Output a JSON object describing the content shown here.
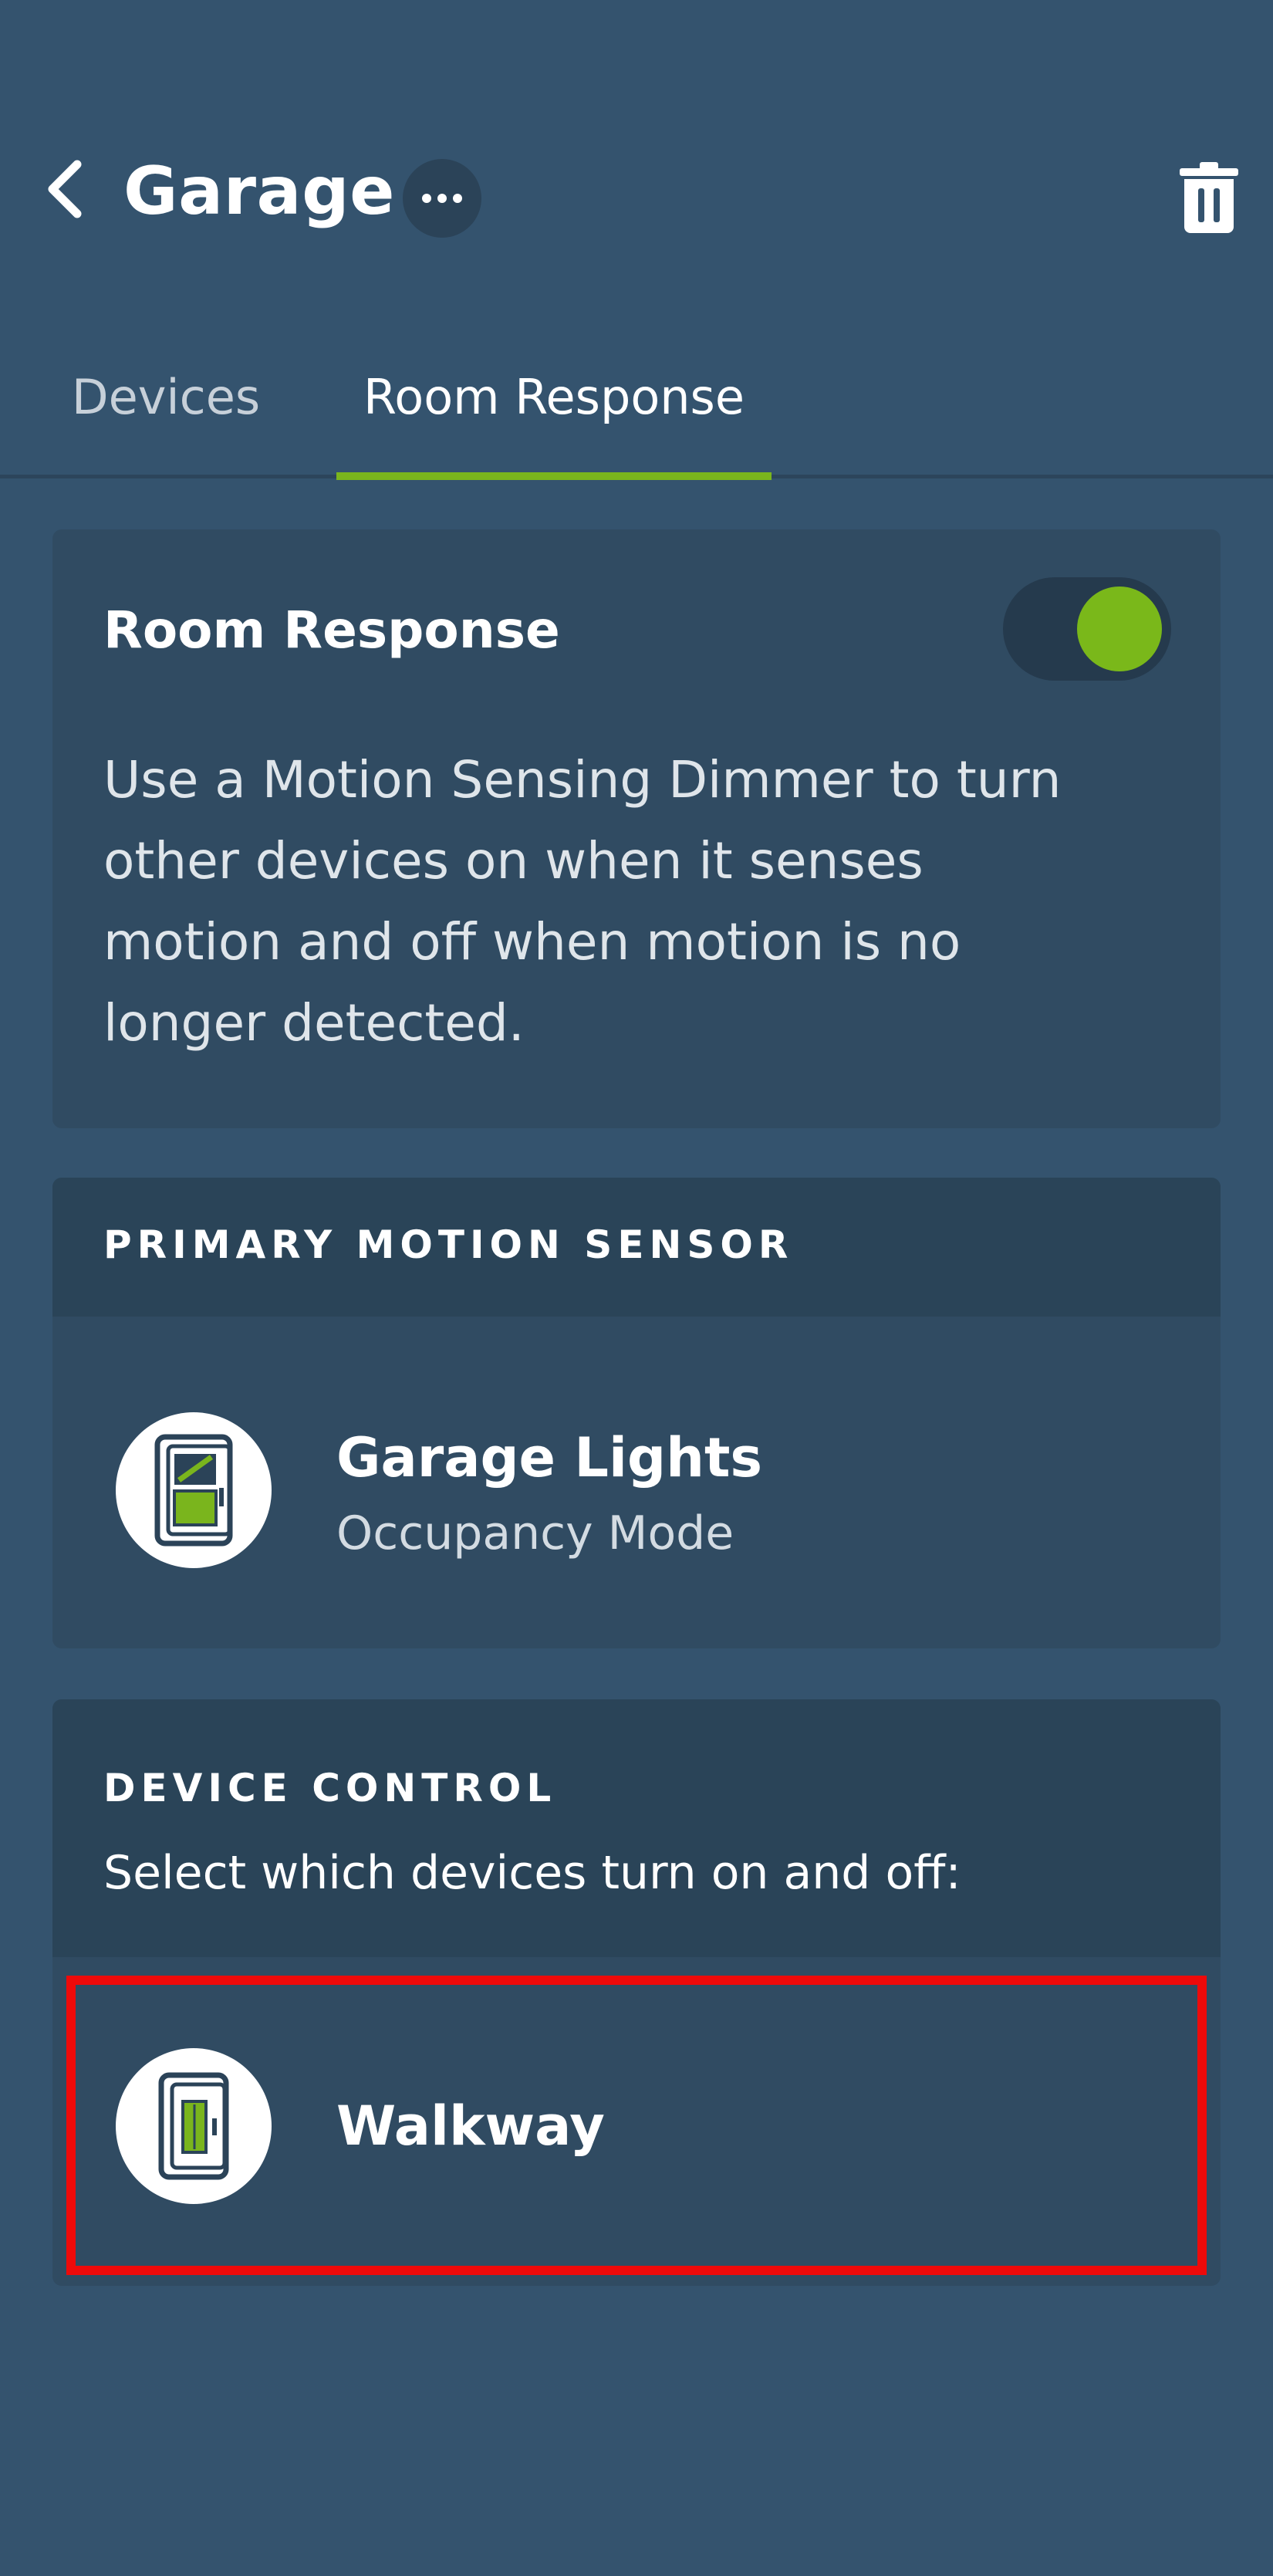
{
  "header": {
    "title": "Garage",
    "back_icon": "chevron-left-icon",
    "more_icon": "more-horizontal-icon",
    "delete_icon": "trash-icon"
  },
  "tabs": [
    {
      "label": "Devices",
      "active": false
    },
    {
      "label": "Room Response",
      "active": true
    }
  ],
  "room_response": {
    "title": "Room Response",
    "enabled": true,
    "description": "Use a Motion Sensing Dimmer to turn other devices on when it senses motion and off when motion is no longer detected."
  },
  "primary_motion_sensor": {
    "heading": "PRIMARY MOTION SENSOR",
    "device": {
      "name": "Garage Lights",
      "mode": "Occupancy Mode",
      "icon": "motion-dimmer-icon"
    }
  },
  "device_control": {
    "heading": "DEVICE CONTROL",
    "instruction": "Select which devices turn on and off:",
    "devices": [
      {
        "name": "Walkway",
        "icon": "light-switch-icon",
        "highlighted": true
      }
    ]
  },
  "colors": {
    "background": "#34536e",
    "card": "#304b62",
    "section_header": "#2a4458",
    "accent_green": "#7ab51d",
    "highlight_red": "#ee0a0a"
  }
}
